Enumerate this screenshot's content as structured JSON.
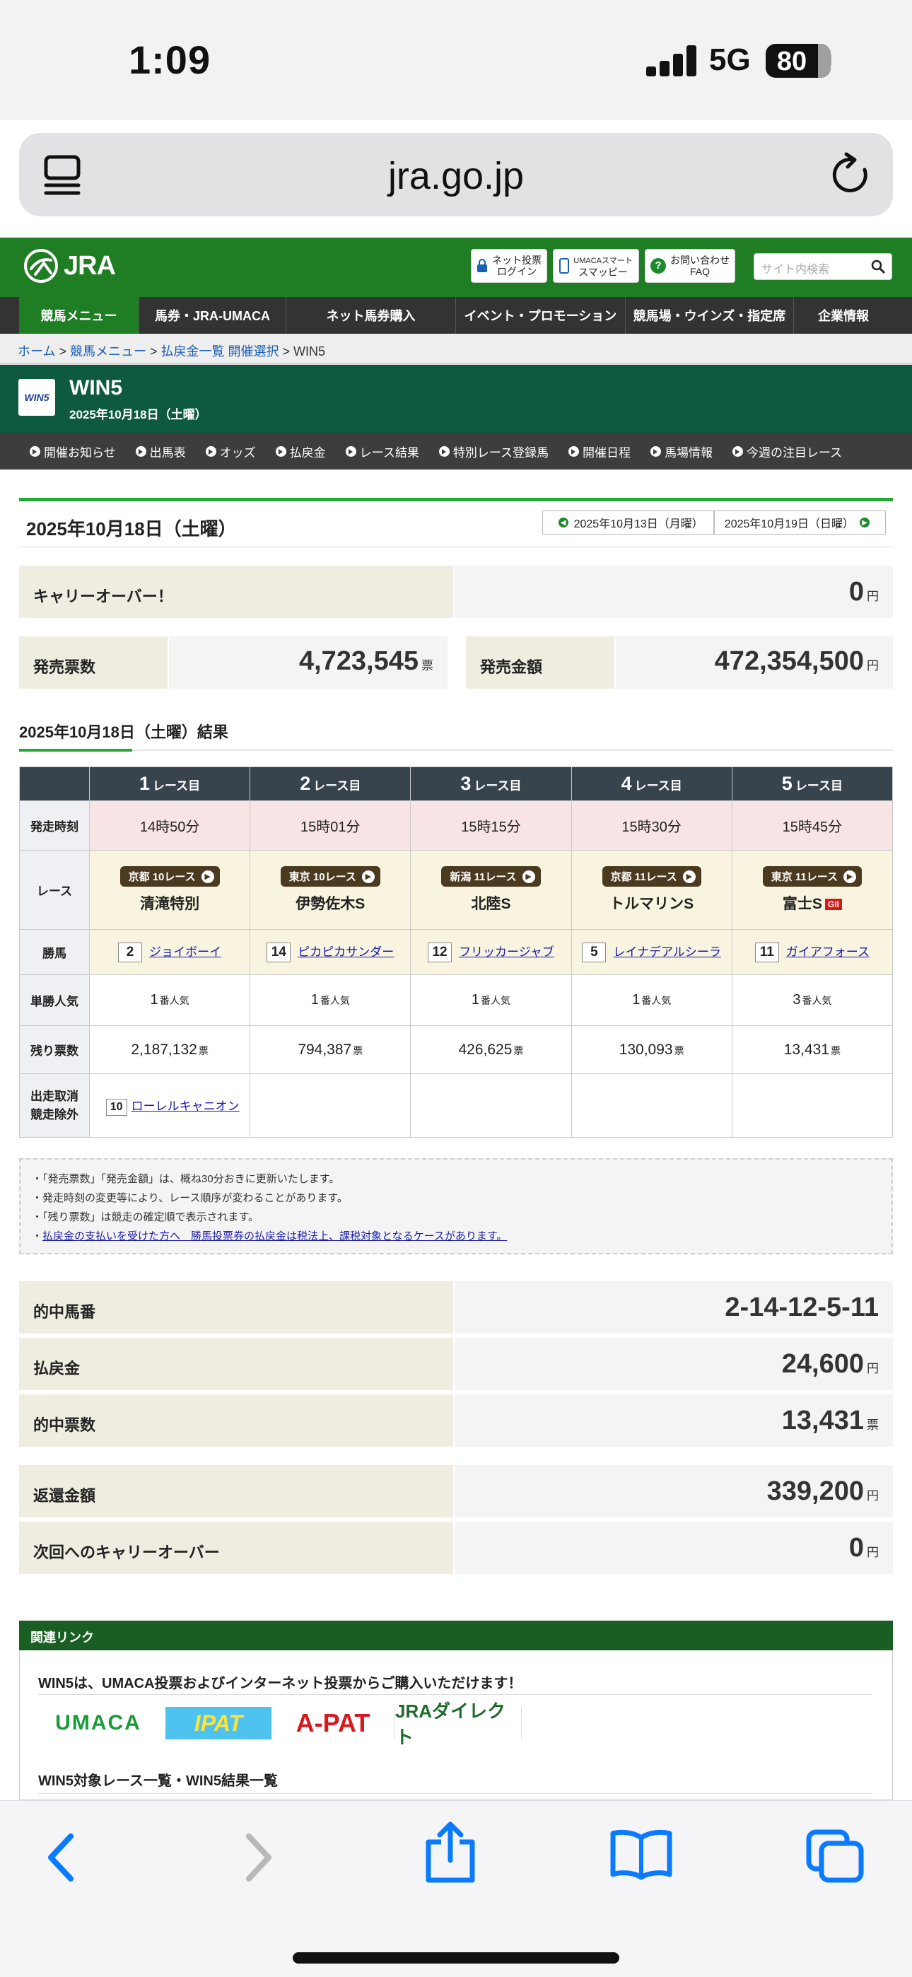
{
  "status": {
    "time": "1:09",
    "network": "5G",
    "battery": "80"
  },
  "browser": {
    "url": "jra.go.jp"
  },
  "header": {
    "logo_text": "JRA",
    "btn_login_line1": "ネット投票",
    "btn_login_line2": "ログイン",
    "btn_umaca_line1": "UMACAスマート",
    "btn_umaca_line2": "スマッピー",
    "btn_faq_line1": "お問い合わせ",
    "btn_faq_line2": "FAQ",
    "search_placeholder": "サイト内検索"
  },
  "nav": [
    "競馬メニュー",
    "馬券・JRA-UMACA",
    "ネット馬券購入",
    "イベント・プロモーション",
    "競馬場・ウインズ・指定席",
    "企業情報"
  ],
  "breadcrumb": {
    "home": "ホーム",
    "menu": "競馬メニュー",
    "select": "払戻金一覧 開催選択",
    "current": "WIN5"
  },
  "page_title": {
    "logo": "WIN5",
    "title": "WIN5",
    "date": "2025年10月18日（土曜）"
  },
  "subnav": [
    "開催お知らせ",
    "出馬表",
    "オッズ",
    "払戻金",
    "レース結果",
    "特別レース登録馬",
    "開催日程",
    "馬場情報",
    "今週の注目レース"
  ],
  "date_row": {
    "title": "2025年10月18日（土曜）",
    "prev": "2025年10月13日（月曜）",
    "next": "2025年10月19日（日曜）"
  },
  "carryover": {
    "label": "キャリーオーバー！",
    "value": "0",
    "unit": "円"
  },
  "sales": {
    "tickets_label": "発売票数",
    "tickets_value": "4,723,545",
    "tickets_unit": "票",
    "amount_label": "発売金額",
    "amount_value": "472,354,500",
    "amount_unit": "円"
  },
  "results_title": "2025年10月18日（土曜）結果",
  "table": {
    "race_suffix": "レース目",
    "row_labels": {
      "time": "発走時刻",
      "race": "レース",
      "winner": "勝馬",
      "popularity": "単勝人気",
      "remaining": "残り票数",
      "scratch_1": "出走取消",
      "scratch_2": "競走除外"
    },
    "popularity_suffix": "番人気",
    "remaining_unit": "票",
    "races": [
      {
        "num": "1",
        "time": "14時50分",
        "venue": "京都 10レース",
        "name": "清滝特別",
        "grade": "",
        "horse_num": "2",
        "horse": "ジョイボーイ",
        "pop": "1",
        "remaining": "2,187,132"
      },
      {
        "num": "2",
        "time": "15時01分",
        "venue": "東京 10レース",
        "name": "伊勢佐木S",
        "grade": "",
        "horse_num": "14",
        "horse": "ピカピカサンダー",
        "pop": "1",
        "remaining": "794,387"
      },
      {
        "num": "3",
        "time": "15時15分",
        "venue": "新潟 11レース",
        "name": "北陸S",
        "grade": "",
        "horse_num": "12",
        "horse": "フリッカージャブ",
        "pop": "1",
        "remaining": "426,625"
      },
      {
        "num": "4",
        "time": "15時30分",
        "venue": "京都 11レース",
        "name": "トルマリンS",
        "grade": "",
        "horse_num": "5",
        "horse": "レイナデアルシーラ",
        "pop": "1",
        "remaining": "130,093"
      },
      {
        "num": "5",
        "time": "15時45分",
        "venue": "東京 11レース",
        "name": "富士S",
        "grade": "GII",
        "horse_num": "11",
        "horse": "ガイアフォース",
        "pop": "3",
        "remaining": "13,431"
      }
    ],
    "scratch": {
      "num": "10",
      "name": "ローレルキャニオン"
    }
  },
  "notes": [
    "「発売票数」「発売金額」は、概ね30分おきに更新いたします。",
    "発走時刻の変更等により、レース順序が変わることがあります。",
    "「残り票数」は競走の確定順で表示されます。",
    "払戻金の支払いを受けた方へ　勝馬投票券の払戻金は税法上、課税対象となるケースがあります。"
  ],
  "payout": {
    "numbers_label": "的中馬番",
    "numbers_value": "2-14-12-5-11",
    "payout_label": "払戻金",
    "payout_value": "24,600",
    "payout_unit": "円",
    "hits_label": "的中票数",
    "hits_value": "13,431",
    "hits_unit": "票",
    "refund_label": "返還金額",
    "refund_value": "339,200",
    "refund_unit": "円",
    "next_label": "次回へのキャリーオーバー",
    "next_value": "0",
    "next_unit": "円"
  },
  "related": {
    "head": "関連リンク",
    "line1": "WIN5は、UMACA投票およびインターネット投票からご購入いただけます！",
    "brands": [
      "UMACA",
      "IPAT",
      "A-PAT",
      "JRAダイレクト"
    ],
    "line2": "WIN5対象レース一覧・WIN5結果一覧"
  },
  "colors": {
    "jra_green": "#1f7d24",
    "win5_green": "#0e5a40",
    "table_head": "#37434d",
    "ios_blue": "#0a7aff"
  }
}
